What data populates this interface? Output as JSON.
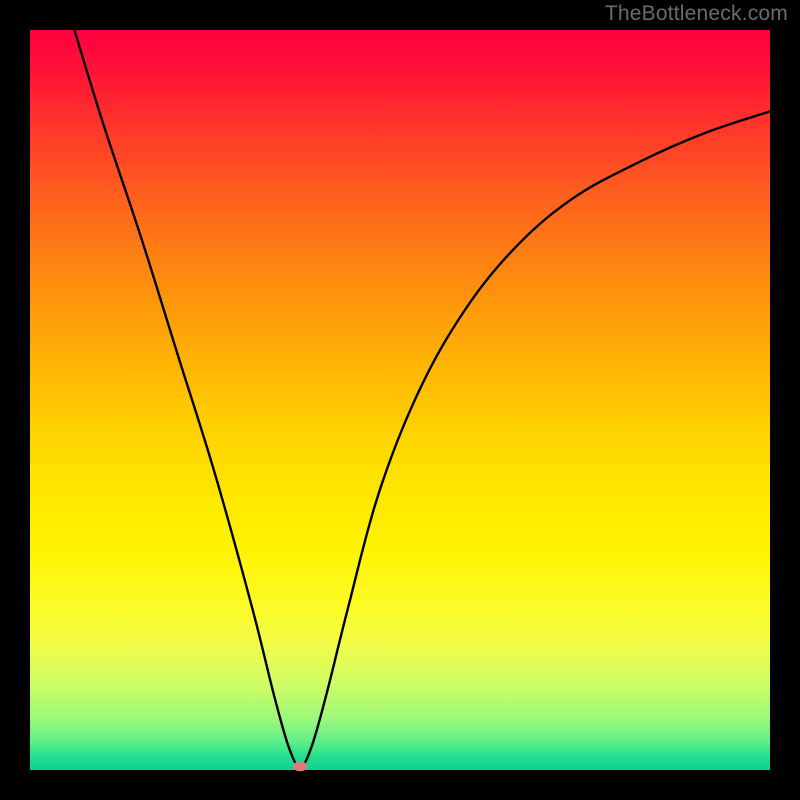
{
  "watermark": "TheBottleneck.com",
  "chart_data": {
    "type": "line",
    "title": "",
    "xlabel": "",
    "ylabel": "",
    "xlim": [
      0,
      100
    ],
    "ylim": [
      0,
      100
    ],
    "grid": false,
    "series": [
      {
        "name": "bottleneck-curve",
        "x": [
          6,
          10,
          15,
          20,
          25,
          30,
          33,
          35,
          36.5,
          38,
          40,
          43,
          47,
          52,
          58,
          65,
          73,
          82,
          91,
          100
        ],
        "values": [
          100,
          87,
          72,
          56,
          40,
          22,
          10,
          3,
          0.5,
          3,
          10,
          22,
          37,
          50,
          61,
          70,
          77,
          82,
          86,
          89
        ]
      }
    ],
    "minimum_marker": {
      "x": 36.5,
      "y": 0.5
    },
    "background_gradient": {
      "top": "#ff0040",
      "mid": "#ffe600",
      "bottom": "#07d391"
    }
  }
}
